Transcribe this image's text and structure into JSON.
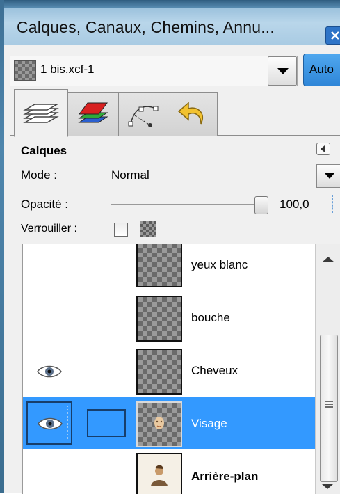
{
  "window": {
    "title": "Calques, Canaux, Chemins, Annu..."
  },
  "image_selector": {
    "value": "1 bis.xcf-1",
    "auto_label": "Auto"
  },
  "tabs": [
    {
      "name": "layers",
      "icon": "layers-icon"
    },
    {
      "name": "channels",
      "icon": "channels-icon"
    },
    {
      "name": "paths",
      "icon": "paths-icon"
    },
    {
      "name": "undo-history",
      "icon": "undo-history-icon"
    }
  ],
  "layers_panel": {
    "title": "Calques",
    "mode_label": "Mode :",
    "mode_value": "Normal",
    "opacity_label": "Opacité :",
    "opacity_value": "100,0",
    "lock_label": "Verrouiller :"
  },
  "layers": [
    {
      "name": "yeux blanc",
      "visible": false,
      "selected": false
    },
    {
      "name": "bouche",
      "visible": false,
      "selected": false
    },
    {
      "name": "Cheveux",
      "visible": true,
      "selected": false
    },
    {
      "name": "Visage",
      "visible": true,
      "selected": true
    },
    {
      "name": "Arrière-plan",
      "visible": false,
      "selected": false,
      "bold": true
    }
  ],
  "colors": {
    "selection": "#3399ff",
    "title_bar": "#a9cbe3",
    "auto_button": "#2f86d8"
  }
}
